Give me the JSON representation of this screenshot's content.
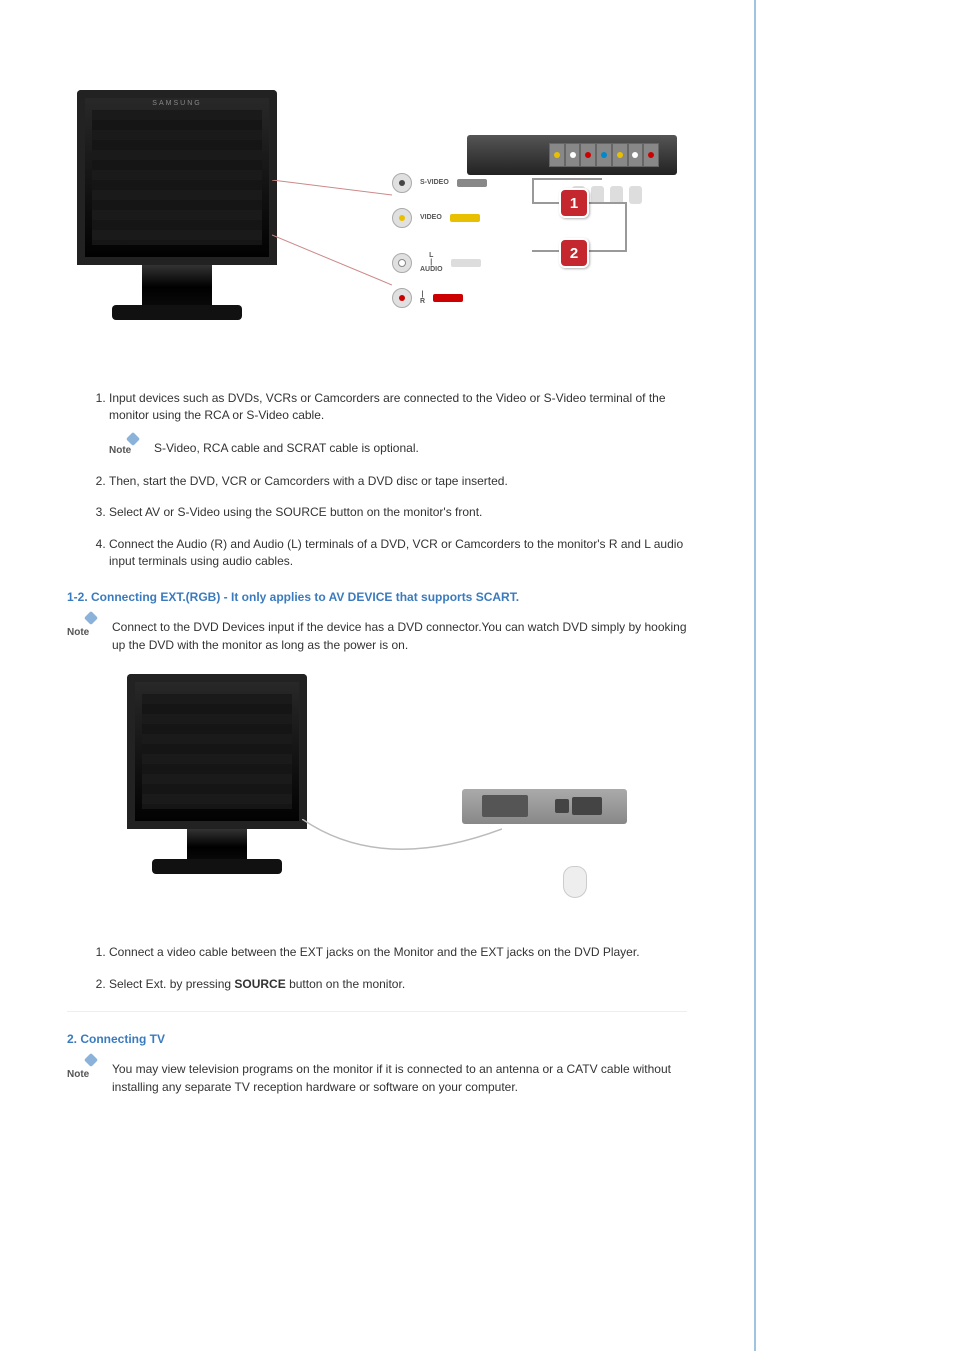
{
  "diagram1": {
    "monitor_brand": "SAMSUNG",
    "ports": {
      "svideo": "S-VIDEO",
      "video": "VIDEO",
      "audio_l": "L",
      "audio_sep": "|",
      "audio_label": "AUDIO",
      "audio_sep2": "|",
      "audio_r": "R"
    },
    "badges": {
      "one": "1",
      "two": "2"
    }
  },
  "note_label": "Note",
  "list1": {
    "item1": "Input devices such as DVDs, VCRs or Camcorders are connected to the Video or S-Video terminal of the monitor using the RCA or S-Video cable.",
    "note1": "S-Video, RCA cable and SCRAT cable is optional.",
    "item2": "Then, start the DVD, VCR or Camcorders with a DVD disc or tape inserted.",
    "item3": "Select AV or S-Video using the SOURCE button on the monitor's front.",
    "item4": "Connect the Audio (R) and Audio (L) terminals of a DVD, VCR or Camcorders to the monitor's R and L audio input terminals using audio cables."
  },
  "section_1_2": {
    "title": "1-2. Connecting EXT.(RGB) - It only applies to AV DEVICE that supports SCART.",
    "note": "Connect to the DVD Devices input if the device has a DVD connector.You can watch DVD simply by hooking up the DVD with the monitor as long as the power is on."
  },
  "list2": {
    "item1": "Connect a video cable between the EXT jacks on the Monitor and the EXT jacks on the DVD Player.",
    "item2_a": "Select Ext. by pressing ",
    "item2_b": "SOURCE",
    "item2_c": " button on the monitor."
  },
  "section_2": {
    "title": "2. Connecting TV",
    "note": "You may view television programs on the monitor if it is connected to an antenna or a CATV cable without installing any separate TV reception hardware or software on your computer."
  }
}
